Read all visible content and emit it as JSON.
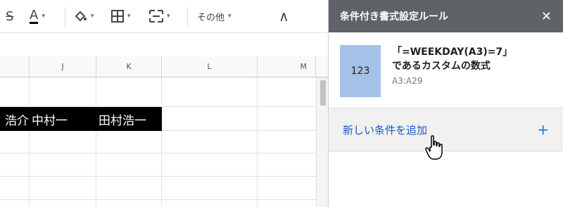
{
  "toolbar": {
    "strike_icon": "S",
    "text_color_icon": "A",
    "more_label": "その他",
    "caret": "▾",
    "collapse": "∧"
  },
  "columns": [
    "J",
    "K",
    "L",
    "M"
  ],
  "cells": {
    "partial": "浩介",
    "cell_j": "中村一",
    "cell_k": "田村浩一"
  },
  "panel": {
    "title": "条件付き書式設定ルール",
    "close": "✕",
    "rule": {
      "preview": "123",
      "line1": "「=WEEKDAY(A3)=7」",
      "line2": "であるカスタムの数式",
      "range": "A3:A29"
    },
    "add_label": "新しい条件を追加",
    "add_icon": "+"
  }
}
